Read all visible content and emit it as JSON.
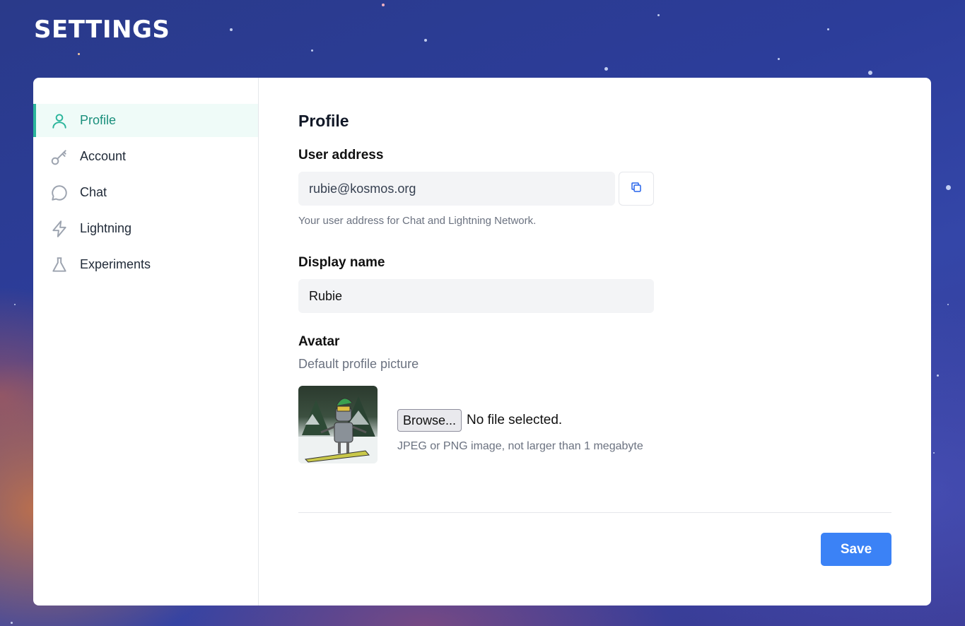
{
  "page": {
    "title": "SETTINGS"
  },
  "sidebar": {
    "items": [
      {
        "label": "Profile",
        "icon": "user-icon",
        "active": true
      },
      {
        "label": "Account",
        "icon": "key-icon",
        "active": false
      },
      {
        "label": "Chat",
        "icon": "chat-bubble-icon",
        "active": false
      },
      {
        "label": "Lightning",
        "icon": "lightning-icon",
        "active": false
      },
      {
        "label": "Experiments",
        "icon": "flask-icon",
        "active": false
      }
    ]
  },
  "profile": {
    "section_title": "Profile",
    "user_address": {
      "label": "User address",
      "value": "rubie@kosmos.org",
      "hint": "Your user address for Chat and Lightning Network."
    },
    "display_name": {
      "label": "Display name",
      "value": "Rubie"
    },
    "avatar": {
      "label": "Avatar",
      "subtitle": "Default profile picture",
      "browse_label": "Browse...",
      "file_status": "No file selected.",
      "file_hint": "JPEG or PNG image, not larger than 1 megabyte"
    },
    "save_label": "Save"
  },
  "colors": {
    "accent": "#2bb59b",
    "active_bg": "#effbf8",
    "primary_button": "#3b82f6"
  }
}
